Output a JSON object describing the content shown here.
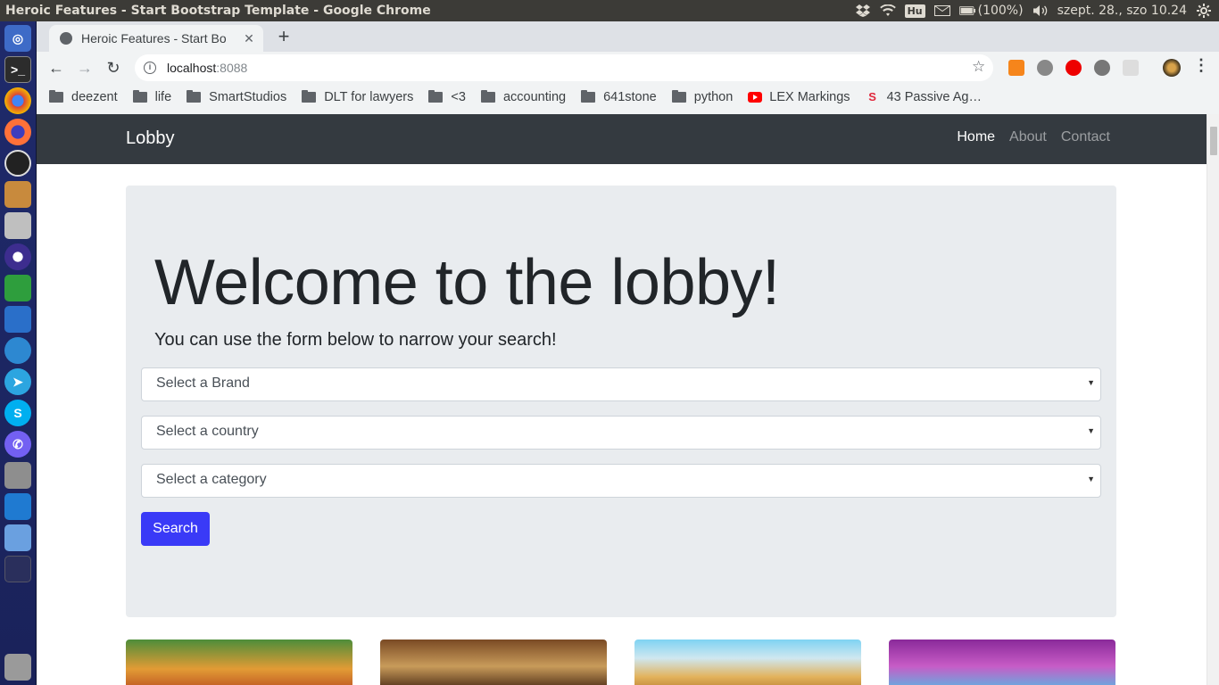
{
  "os": {
    "window_title": "Heroic Features - Start Bootstrap Template - Google Chrome",
    "keyboard_layout": "Hu",
    "battery": "(100%)",
    "datetime": "szept. 28., szo 10.24"
  },
  "launcher": {
    "apps": [
      "ubuntu-dash-icon",
      "terminal-icon",
      "chrome-icon",
      "firefox-icon",
      "obs-icon",
      "package-icon",
      "disks-icon",
      "eclipse-icon",
      "spreadsheet-icon",
      "writer-icon",
      "messaging-icon",
      "telegram-icon",
      "skype-icon",
      "viber-icon",
      "files-icon",
      "vscode-icon",
      "remote-desktop-icon",
      "workspace-icon",
      "trash-icon"
    ]
  },
  "browser": {
    "tab_title": "Heroic Features - Start Bo",
    "url_host": "localhost",
    "url_port": ":8088",
    "bookmarks": [
      {
        "label": "deezent",
        "icon": "folder-icon"
      },
      {
        "label": "life",
        "icon": "folder-icon"
      },
      {
        "label": "SmartStudios",
        "icon": "folder-icon"
      },
      {
        "label": "DLT for lawyers",
        "icon": "folder-icon"
      },
      {
        "label": "<3",
        "icon": "folder-icon"
      },
      {
        "label": "accounting",
        "icon": "folder-icon"
      },
      {
        "label": "641stone",
        "icon": "folder-icon"
      },
      {
        "label": "python",
        "icon": "folder-icon"
      },
      {
        "label": "LEX Markings",
        "icon": "youtube-icon"
      },
      {
        "label": "43 Passive Ag…",
        "icon": "bookmark-s-icon"
      }
    ]
  },
  "site": {
    "brand": "Lobby",
    "nav": [
      {
        "label": "Home",
        "active": true
      },
      {
        "label": "About",
        "active": false
      },
      {
        "label": "Contact",
        "active": false
      }
    ],
    "hero": {
      "title": "Welcome to the lobby!",
      "lead": "You can use the form below to narrow your search!"
    },
    "form": {
      "brand_select": "Select a Brand",
      "country_select": "Select a country",
      "category_select": "Select a category",
      "search_label": "Search"
    },
    "colors": {
      "navbar": "#343a40",
      "jumbotron": "#e9ecef",
      "button": "#3a3af7"
    }
  }
}
